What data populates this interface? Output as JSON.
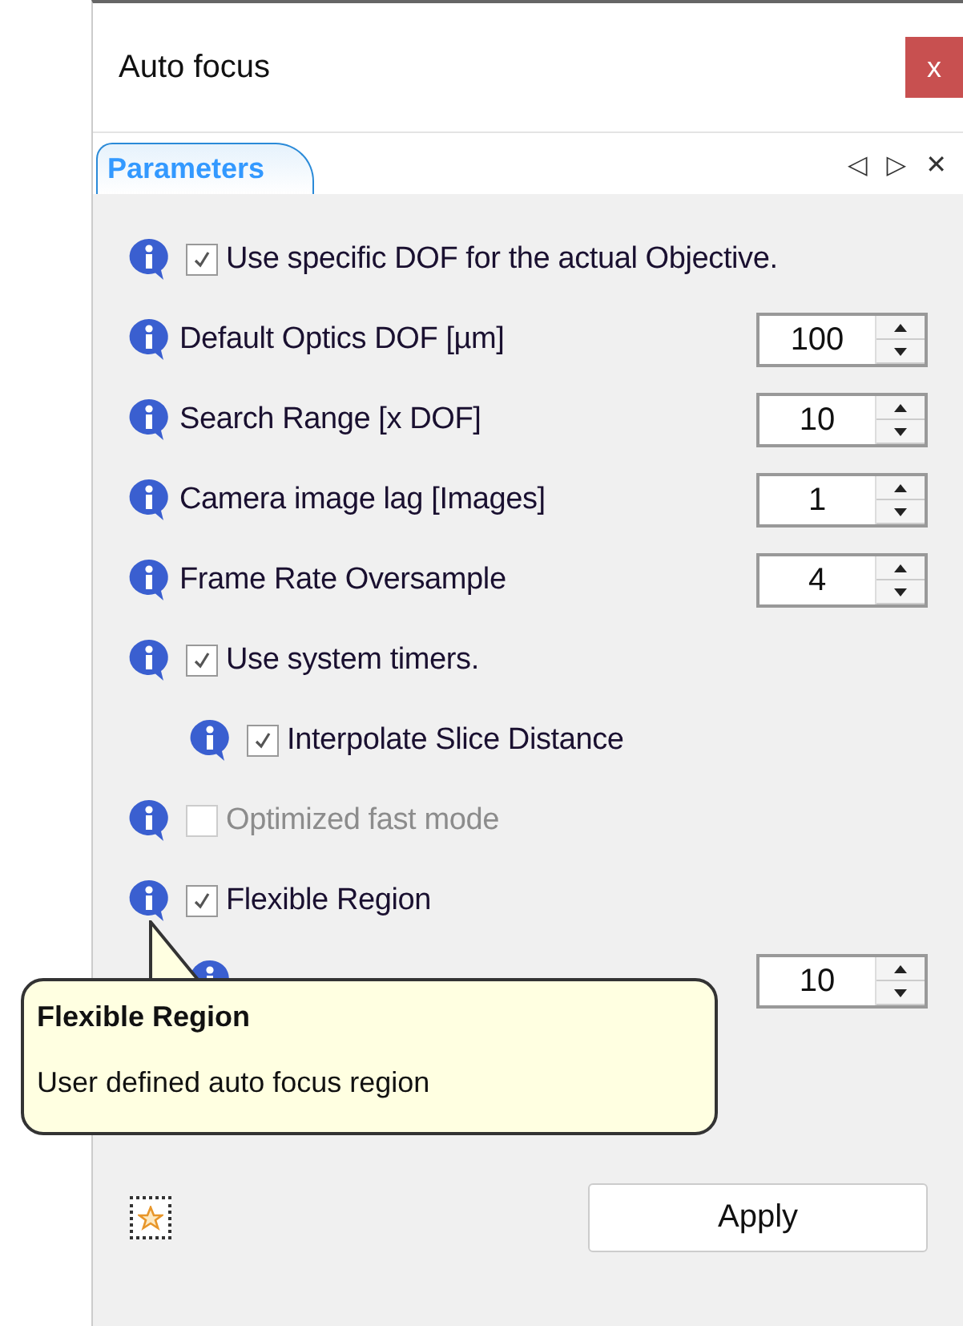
{
  "window": {
    "title": "Auto focus",
    "close": "x"
  },
  "tabs": [
    {
      "label": "Parameters",
      "selected": true
    }
  ],
  "tab_controls": [
    "◁",
    "▷",
    "✕"
  ],
  "rows": [
    {
      "kind": "check",
      "label": "Use specific DOF for the actual Objective.",
      "checked": true,
      "disabled": false
    },
    {
      "kind": "spin",
      "label": "Default Optics DOF [µm]",
      "value": "100"
    },
    {
      "kind": "spin",
      "label": "Search Range [x DOF]",
      "value": "10"
    },
    {
      "kind": "spin",
      "label": "Camera image lag [Images]",
      "value": "1"
    },
    {
      "kind": "spin",
      "label": "Frame Rate Oversample",
      "value": "4"
    },
    {
      "kind": "check",
      "label": "Use system timers.",
      "checked": true,
      "disabled": false,
      "children": [
        {
          "kind": "check",
          "label": "Interpolate Slice Distance",
          "checked": true,
          "disabled": false
        }
      ]
    },
    {
      "kind": "check",
      "label": "Optimized fast mode",
      "checked": false,
      "disabled": true
    },
    {
      "kind": "check",
      "label": "Flexible Region",
      "checked": true,
      "disabled": false,
      "children": [
        {
          "kind": "spin",
          "value": "10"
        }
      ]
    }
  ],
  "tooltip": {
    "title": "Flexible Region",
    "text": "User defined auto focus region"
  },
  "buttons": [
    {
      "label": "Apply"
    }
  ]
}
